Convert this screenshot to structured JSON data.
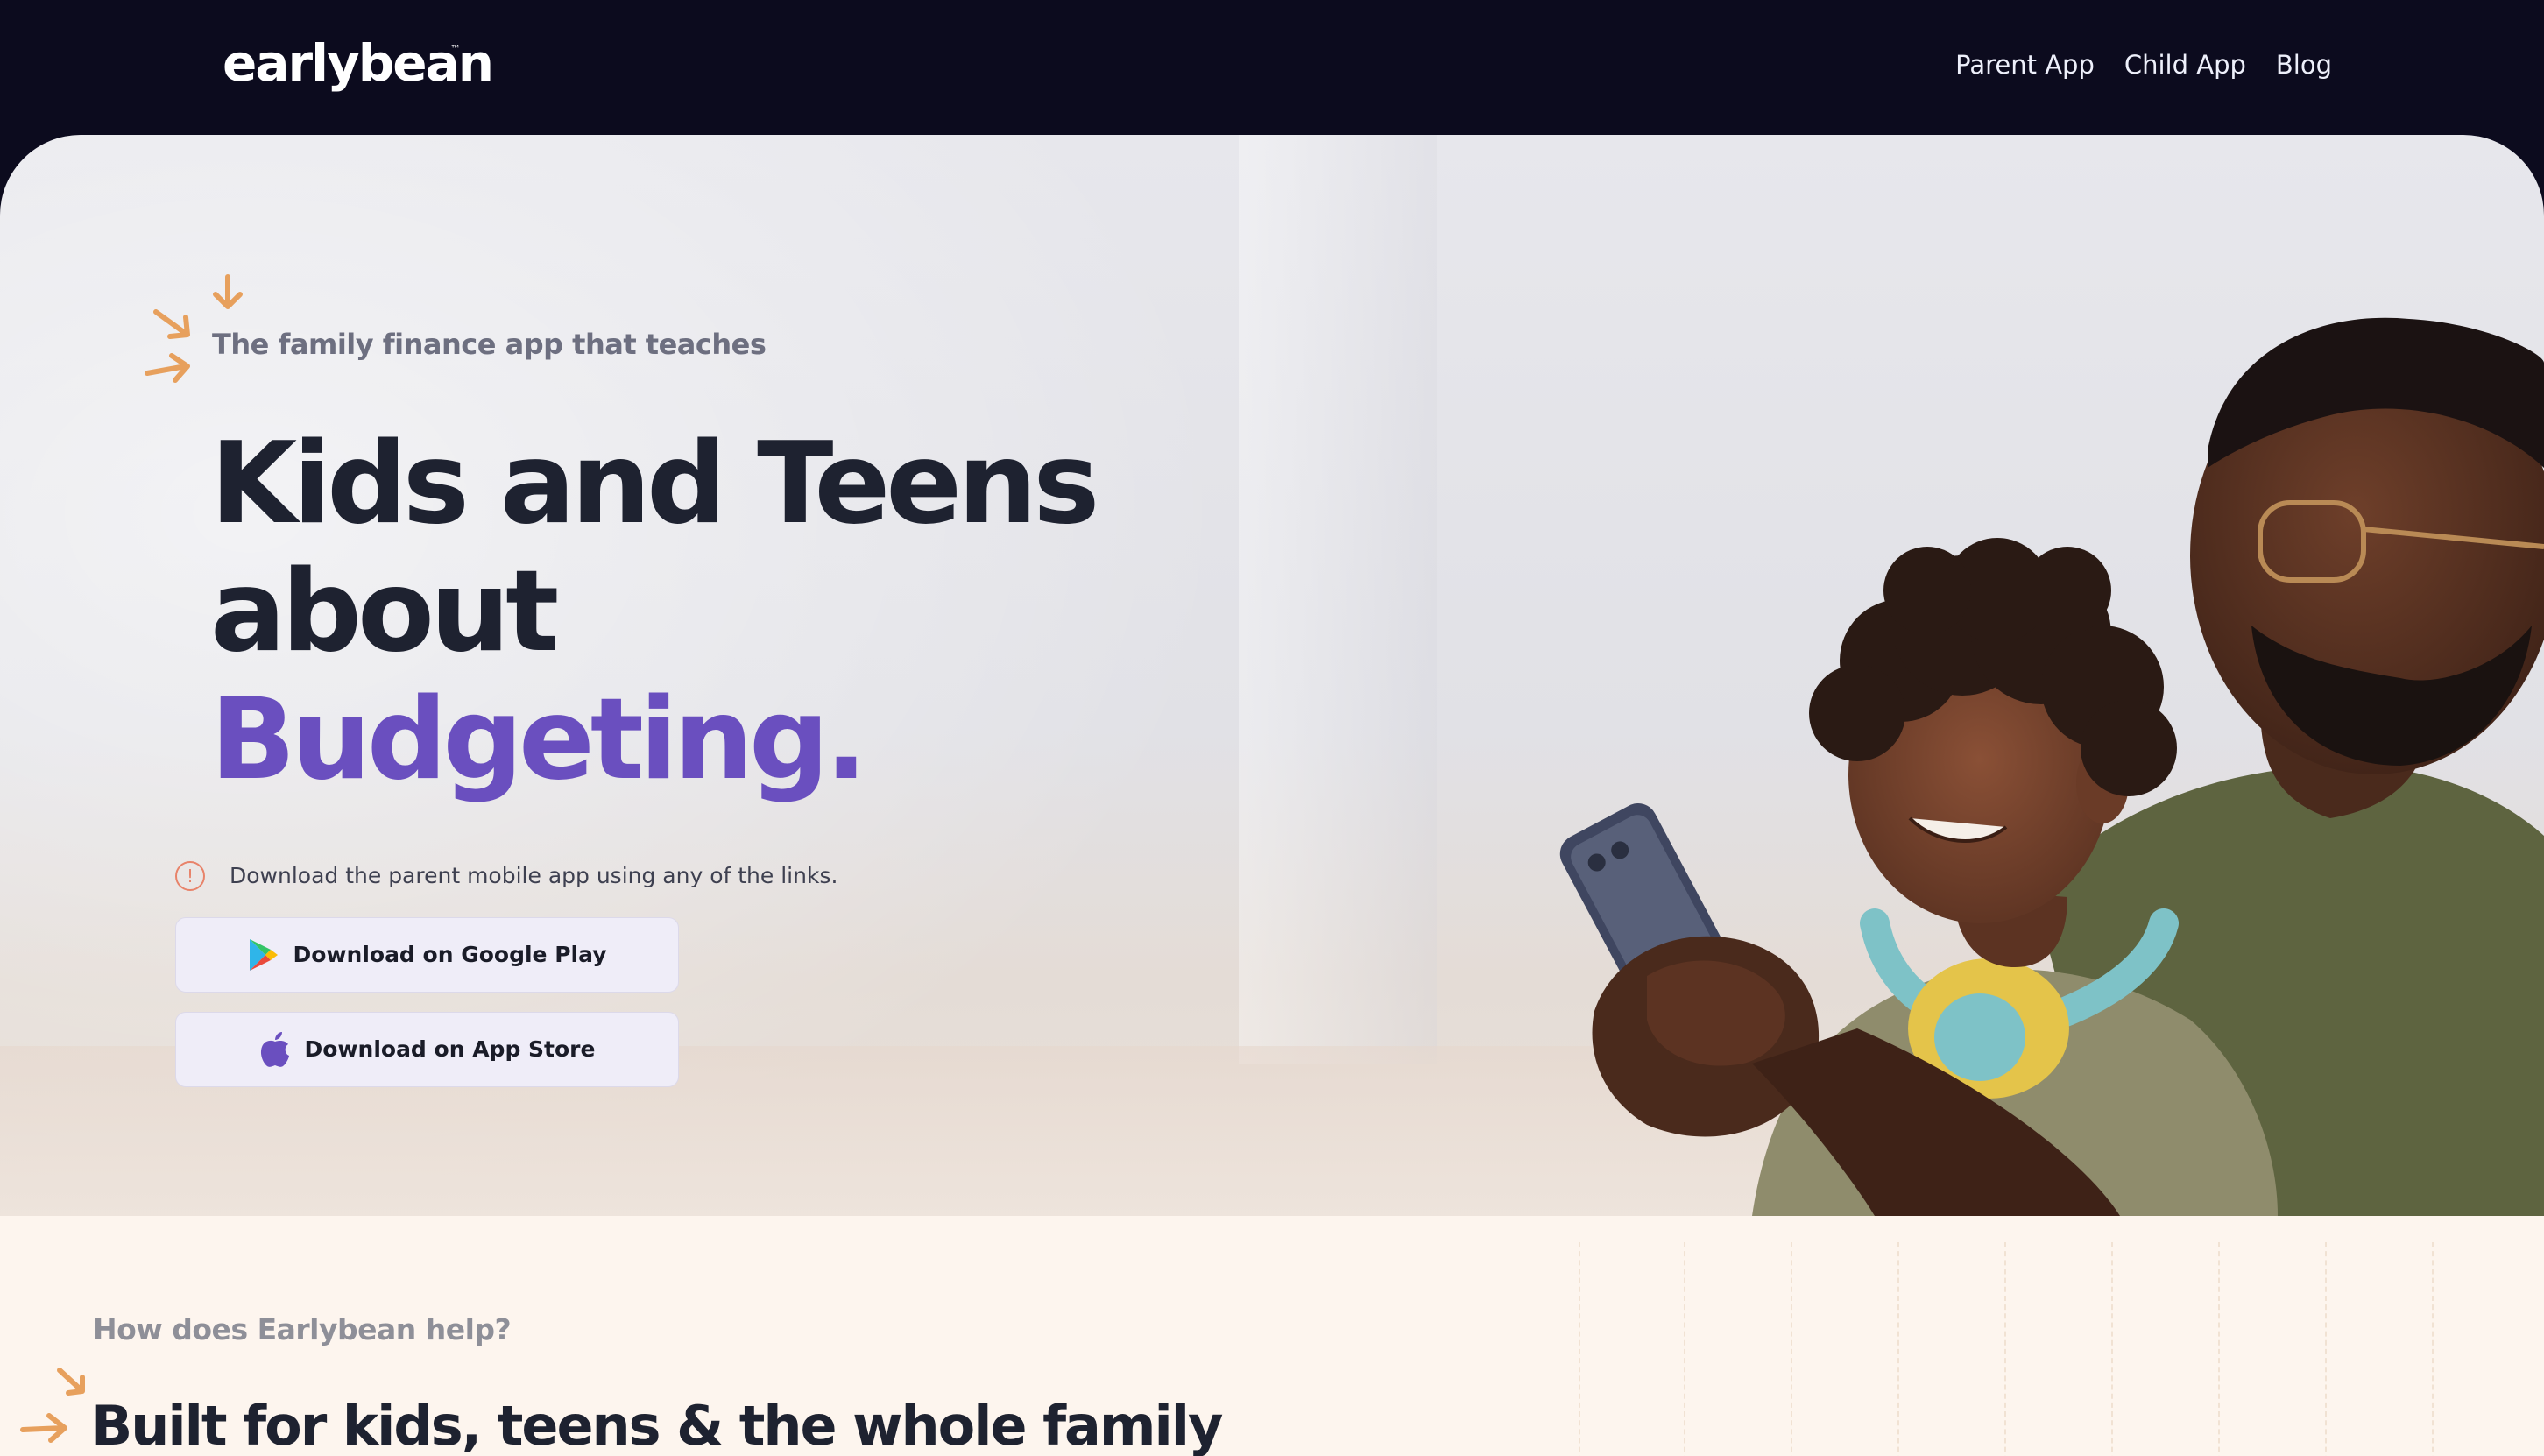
{
  "header": {
    "logo": "earlybean",
    "logo_mark": "™",
    "nav": [
      {
        "label": "Parent App"
      },
      {
        "label": "Child App"
      },
      {
        "label": "Blog"
      }
    ]
  },
  "hero": {
    "tagline": "The family finance app that teaches",
    "headline": {
      "line1": "Kids and Teens",
      "line2": "about",
      "line3": "Budgeting."
    },
    "notice": {
      "icon": "info-icon",
      "icon_glyph": "!",
      "text": "Download the parent mobile app using any of the links."
    },
    "buttons": {
      "google_play": {
        "label": "Download on Google Play",
        "icon": "google-play-icon"
      },
      "app_store": {
        "label": "Download on App Store",
        "icon": "apple-icon"
      }
    },
    "photo": "father-and-son-with-phone"
  },
  "section": {
    "kicker": "How does Earlybean help?",
    "title": "Built for kids, teens & the whole family"
  },
  "colors": {
    "header_bg": "#0c0b1e",
    "headline": "#1e2230",
    "accent_purple": "#6a4fbf",
    "arrow_orange": "#e7a05d",
    "notice_icon": "#e8836a",
    "button_bg": "#efedf8",
    "section_bg": "#fdf5ee"
  }
}
